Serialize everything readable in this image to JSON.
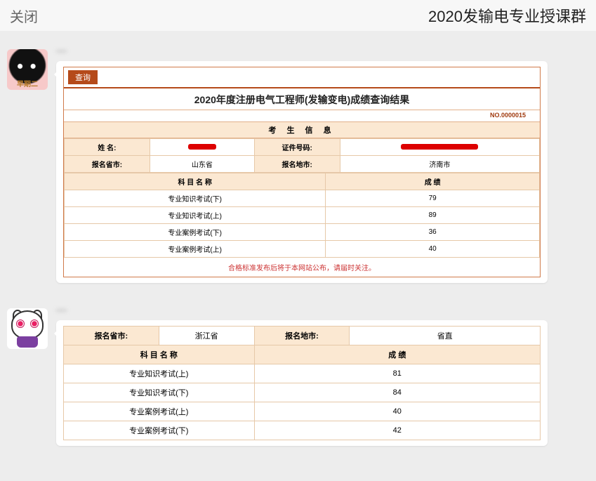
{
  "header": {
    "close": "关闭",
    "title": "2020发输电专业授课群"
  },
  "avatar1_label": "早期二",
  "msg1": {
    "sender": "—",
    "card": {
      "tab": "查询",
      "title": "2020年度注册电气工程师(发输变电)成绩查询结果",
      "docno": "NO.0000015",
      "section_info": "考 生 信 息",
      "info": {
        "name_label": "姓   名:",
        "name_value": "",
        "id_label": "证件号码:",
        "id_value": "",
        "prov_label": "报名省市:",
        "prov_value": "山东省",
        "city_label": "报名地市:",
        "city_value": "济南市"
      },
      "score_head_subject": "科 目 名 称",
      "score_head_score": "成   绩",
      "scores": [
        {
          "subject": "专业知识考试(下)",
          "score": "79"
        },
        {
          "subject": "专业知识考试(上)",
          "score": "89"
        },
        {
          "subject": "专业案例考试(下)",
          "score": "36"
        },
        {
          "subject": "专业案例考试(上)",
          "score": "40"
        }
      ],
      "footer": "合格标准发布后将于本网站公布，请届时关注。"
    }
  },
  "msg2": {
    "sender": "—",
    "card": {
      "prov_label": "报名省市:",
      "prov_value": "浙江省",
      "city_label": "报名地市:",
      "city_value": "省直",
      "score_head_subject": "科 目 名 称",
      "score_head_score": "成   绩",
      "scores": [
        {
          "subject": "专业知识考试(上)",
          "score": "81"
        },
        {
          "subject": "专业知识考试(下)",
          "score": "84"
        },
        {
          "subject": "专业案例考试(上)",
          "score": "40"
        },
        {
          "subject": "专业案例考试(下)",
          "score": "42"
        }
      ]
    }
  }
}
